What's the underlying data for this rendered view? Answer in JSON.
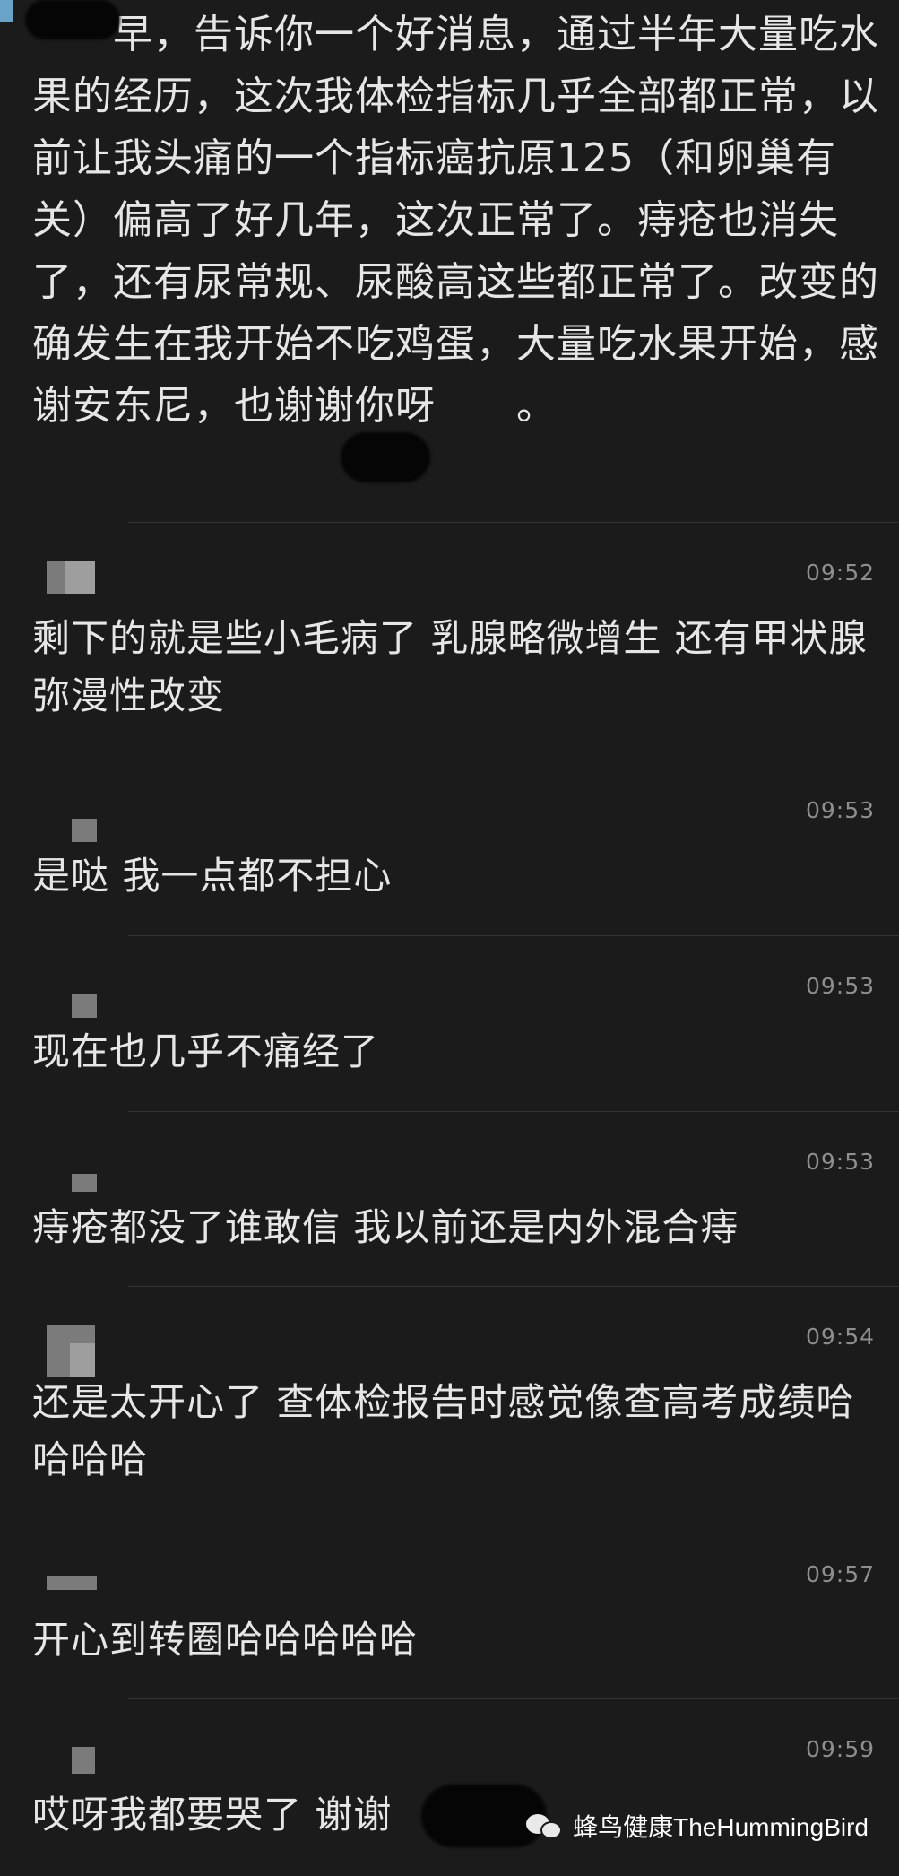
{
  "first_message": {
    "text": "　　早，告诉你一个好消息，通过半年大量吃水果的经历，这次我体检指标几乎全部都正常，以前让我头痛的一个指标癌抗原125（和卵巢有关）偏高了好几年，这次正常了。痔疮也消失了，还有尿常规、尿酸高这些都正常了。改变的确发生在我开始不吃鸡蛋，大量吃水果开始，感谢安东尼，也谢谢你呀　　。"
  },
  "messages": [
    {
      "time": "09:52",
      "text": "剩下的就是些小毛病了  乳腺略微增生  还有甲状腺弥漫性改变"
    },
    {
      "time": "09:53",
      "text": "是哒  我一点都不担心"
    },
    {
      "time": "09:53",
      "text": "现在也几乎不痛经了"
    },
    {
      "time": "09:53",
      "text": "痔疮都没了谁敢信  我以前还是内外混合痔"
    },
    {
      "time": "09:54",
      "text": "还是太开心了  查体检报告时感觉像查高考成绩哈哈哈哈"
    },
    {
      "time": "09:57",
      "text": "开心到转圈哈哈哈哈哈"
    },
    {
      "time": "09:59",
      "text": "哎呀我都要哭了  谢谢"
    }
  ],
  "watermark": {
    "label": "蜂鸟健康TheHummingBird",
    "icon": "wechat-icon"
  },
  "colors": {
    "background": "#1b1b1b",
    "text": "#e6e6e6",
    "timestamp": "#8e8e8e",
    "divider": "#343434"
  }
}
